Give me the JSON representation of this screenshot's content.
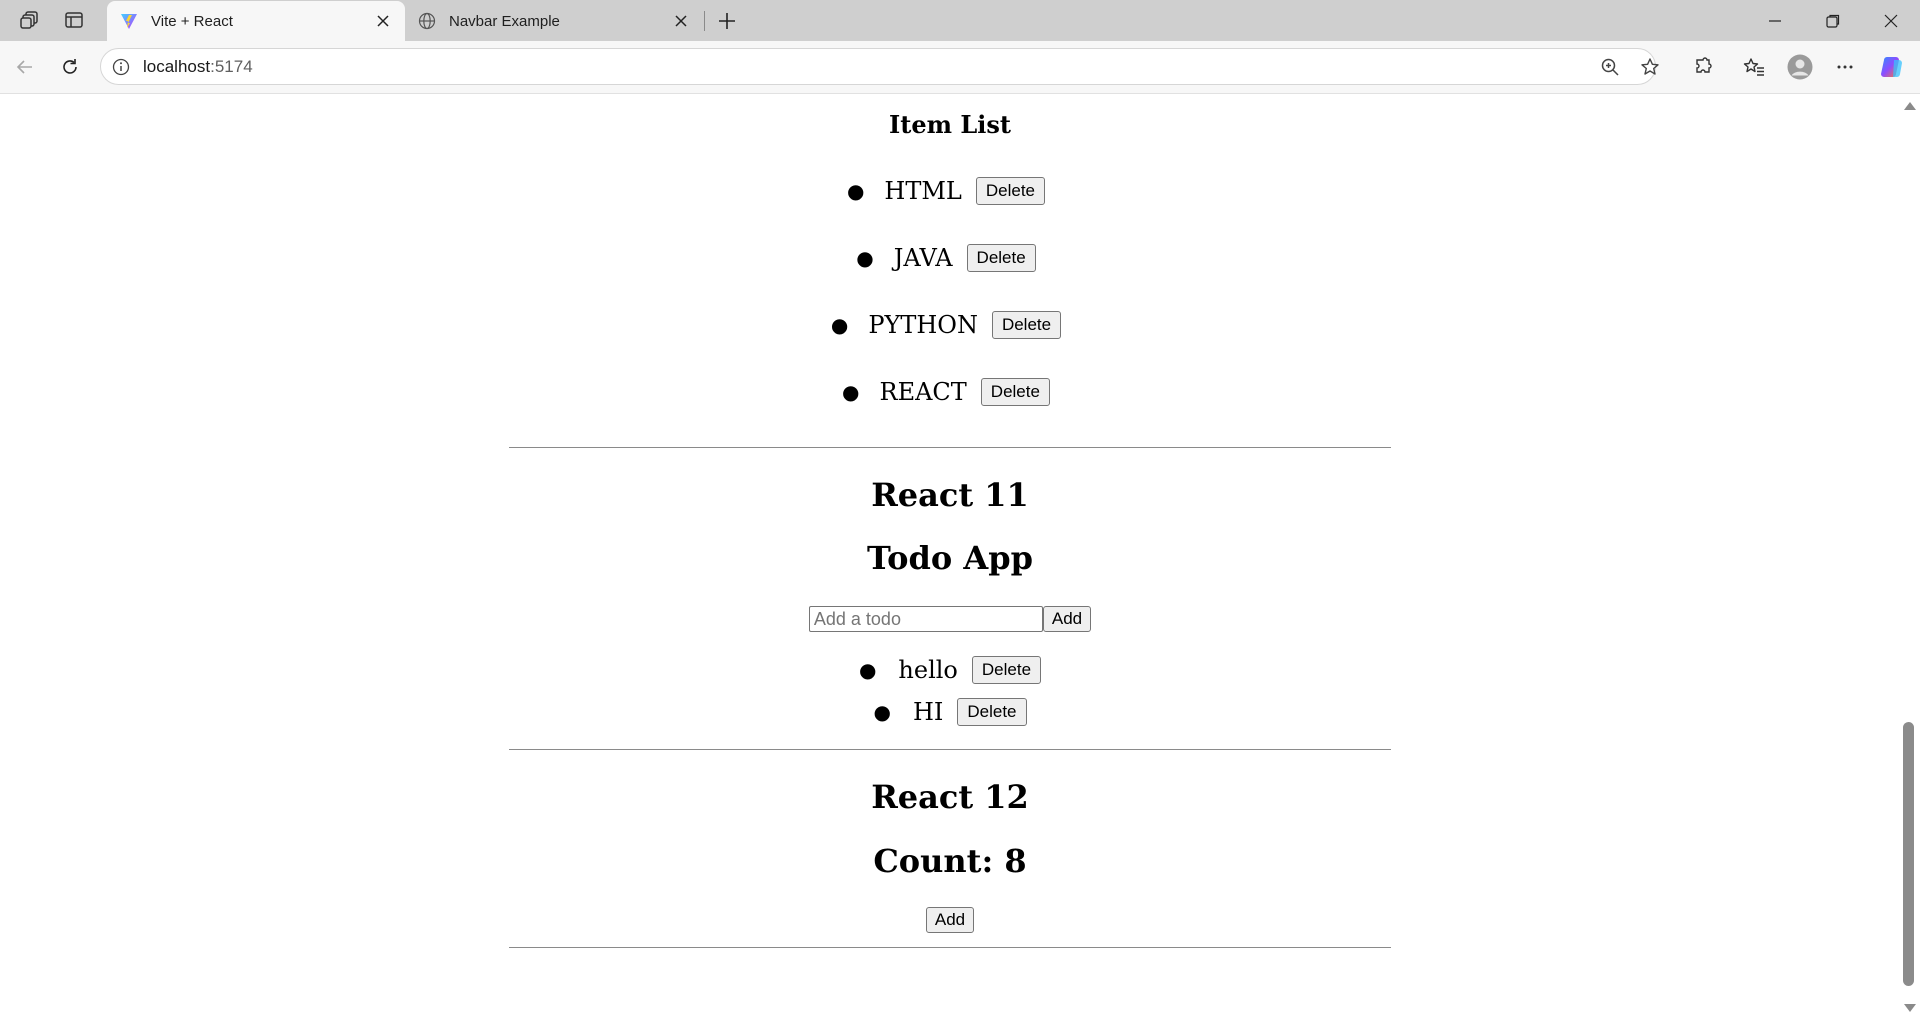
{
  "browser": {
    "tabs": [
      {
        "title": "Vite + React",
        "active": true
      },
      {
        "title": "Navbar Example",
        "active": false
      }
    ],
    "address": {
      "host": "localhost",
      "port": ":5174"
    }
  },
  "page": {
    "item_list": {
      "title": "Item List",
      "items": [
        {
          "label": "HTML",
          "action": "Delete"
        },
        {
          "label": "JAVA",
          "action": "Delete"
        },
        {
          "label": "PYTHON",
          "action": "Delete"
        },
        {
          "label": "REACT",
          "action": "Delete"
        }
      ]
    },
    "react11": {
      "heading": "React 11",
      "app_title": "Todo App",
      "input_placeholder": "Add a todo",
      "add_label": "Add",
      "todos": [
        {
          "label": "hello",
          "action": "Delete"
        },
        {
          "label": "HI",
          "action": "Delete"
        }
      ]
    },
    "react12": {
      "heading": "React 12",
      "count_text": "Count: 8",
      "add_label": "Add"
    }
  },
  "colors": {
    "tabstrip": "#cfcfcf",
    "toolbar": "#f7f7f7",
    "button_bg": "#efefef"
  }
}
